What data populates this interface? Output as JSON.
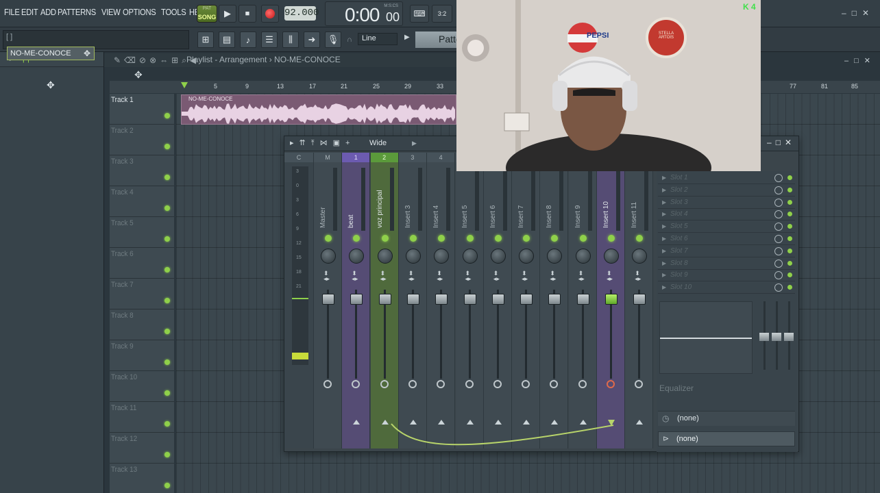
{
  "menu": [
    "FILE",
    "EDIT",
    "ADD",
    "PATTERNS",
    "VIEW",
    "OPTIONS",
    "TOOLS",
    "HELP"
  ],
  "transport": {
    "pat_label": "PAT",
    "song_label": "SONG",
    "tempo": "92.000",
    "time": "0:00",
    "time_small": "00",
    "time_unit": "M:S:CS"
  },
  "hint_text": "[ ]",
  "snap_mode": "Line",
  "pattern_button": "Patte",
  "playlist": {
    "title": "Playlist - Arrangement  ›  NO-ME-CONOCE",
    "ruler": [
      "5",
      "9",
      "13",
      "17",
      "21",
      "25",
      "29",
      "33",
      "77",
      "81",
      "85"
    ],
    "tracks": [
      "Track 1",
      "Track 2",
      "Track 3",
      "Track 4",
      "Track 5",
      "Track 6",
      "Track 7",
      "Track 8",
      "Track 9",
      "Track 10",
      "Track 11",
      "Track 12",
      "Track 13"
    ],
    "clip_name": "NO-ME-CONOCE"
  },
  "browser": {
    "pattern": "NO-ME-CONOCE"
  },
  "mixer": {
    "preset": "Wide",
    "channels": [
      {
        "num": "C",
        "name": ""
      },
      {
        "num": "M",
        "name": "Master"
      },
      {
        "num": "1",
        "name": "beat"
      },
      {
        "num": "2",
        "name": "voz principal"
      },
      {
        "num": "3",
        "name": "Insert 3"
      },
      {
        "num": "4",
        "name": "Insert 4"
      },
      {
        "num": "",
        "name": "Insert 5"
      },
      {
        "num": "",
        "name": "Insert 6"
      },
      {
        "num": "",
        "name": "Insert 7"
      },
      {
        "num": "",
        "name": "Insert 8"
      },
      {
        "num": "",
        "name": "Insert 9"
      },
      {
        "num": "",
        "name": "Insert 10"
      },
      {
        "num": "",
        "name": "Insert 11"
      }
    ],
    "slots": [
      "Slot 1",
      "Slot 2",
      "Slot 3",
      "Slot 4",
      "Slot 5",
      "Slot 6",
      "Slot 7",
      "Slot 8",
      "Slot 9",
      "Slot 10"
    ],
    "eq_label": "Equalizer",
    "input": "(none)",
    "output": "(none)",
    "db_scale": [
      "3",
      "0",
      "3",
      "6",
      "9",
      "12",
      "15",
      "18",
      "21"
    ]
  },
  "webcam": {
    "pepsi": "PEPSI",
    "stella": "STELLA ARTOIS",
    "k_badge": "K 4"
  },
  "colors": {
    "accent": "#8fd04a",
    "selected_purple": "#554c74",
    "selected_green": "#4f6a3c",
    "pattern_clip": "#7a5a73"
  }
}
